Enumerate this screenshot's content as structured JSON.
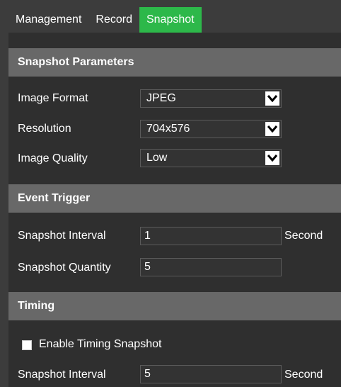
{
  "tabs": [
    {
      "label": "Management",
      "active": false
    },
    {
      "label": "Record",
      "active": false
    },
    {
      "label": "Snapshot",
      "active": true
    }
  ],
  "colors": {
    "accent": "#2db84a",
    "section_bg": "#686868",
    "panel_bg": "#2f2f2f"
  },
  "snapshot_parameters": {
    "title": "Snapshot Parameters",
    "image_format": {
      "label": "Image Format",
      "value": "JPEG"
    },
    "resolution": {
      "label": "Resolution",
      "value": "704x576"
    },
    "image_quality": {
      "label": "Image Quality",
      "value": "Low"
    }
  },
  "event_trigger": {
    "title": "Event Trigger",
    "snapshot_interval": {
      "label": "Snapshot Interval",
      "value": "1",
      "unit": "Second"
    },
    "snapshot_quantity": {
      "label": "Snapshot Quantity",
      "value": "5"
    }
  },
  "timing": {
    "title": "Timing",
    "enable_timing_snapshot": {
      "label": "Enable Timing Snapshot",
      "checked": false
    },
    "snapshot_interval": {
      "label": "Snapshot Interval",
      "value": "5",
      "unit": "Second"
    }
  }
}
